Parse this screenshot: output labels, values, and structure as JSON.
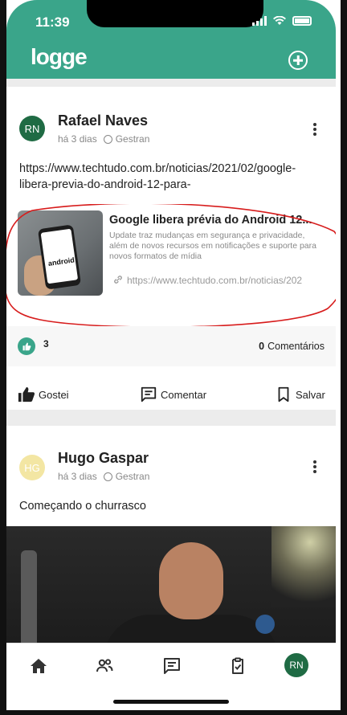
{
  "status_bar": {
    "time": "11:39"
  },
  "header": {
    "logo": "logge",
    "add_icon": "plus-circle-icon"
  },
  "posts": [
    {
      "author": "Rafael Naves",
      "initials": "RN",
      "avatar_color": "#1f6b44",
      "time": "há 3 dias",
      "group": "Gestran",
      "text": "https://www.techtudo.com.br/noticias/2021/02/google-libera-previa-do-android-12-para-",
      "link_card": {
        "title": "Google libera prévia do Android 12...",
        "description": "Update traz mudanças em segurança e privacidade, além de novos recursos em notificações e suporte para novos formatos de mídia",
        "url": "https://www.techtudo.com.br/noticias/202",
        "thumb_text": "android"
      },
      "likes": "3",
      "comments_count": "0",
      "comments_label": "Comentários",
      "actions": {
        "like": "Gostei",
        "comment": "Comentar",
        "save": "Salvar"
      }
    },
    {
      "author": "Hugo Gaspar",
      "initials": "HG",
      "avatar_color": "#f3e6a3",
      "time": "há 3 dias",
      "group": "Gestran",
      "text": "Começando o churrasco"
    }
  ],
  "bottom_nav": {
    "items": [
      "home-icon",
      "people-icon",
      "chat-icon",
      "clipboard-check-icon"
    ],
    "avatar": "RN"
  },
  "colors": {
    "brand": "#3aa58a",
    "annotation": "#d71c1c"
  }
}
